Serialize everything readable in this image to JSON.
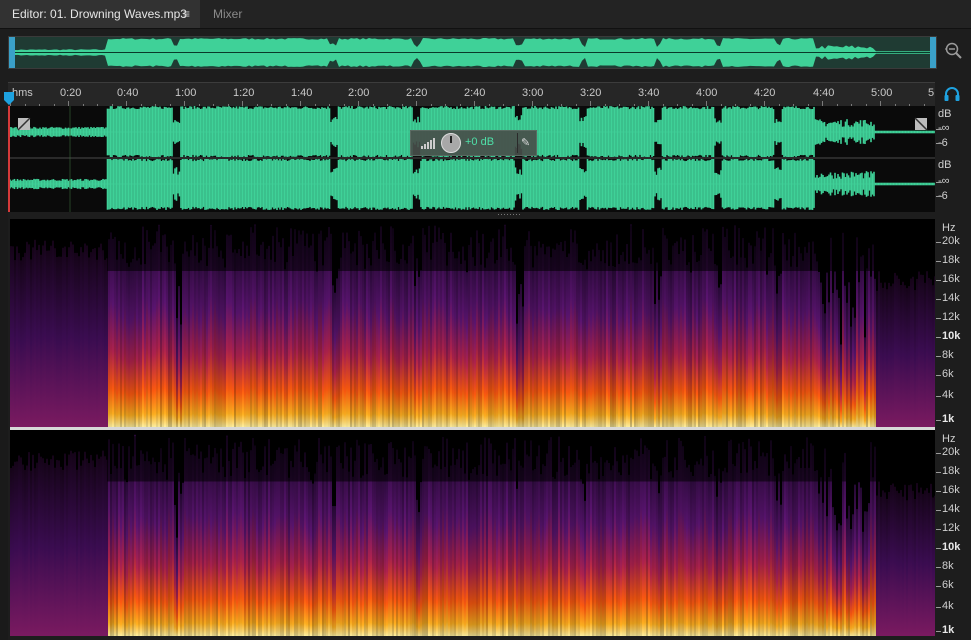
{
  "tabs": {
    "editor": "Editor: 01. Drowning Waves.mp3",
    "menu_glyph": "≡",
    "mixer": "Mixer"
  },
  "ruler": {
    "unit": "hms",
    "labels": [
      "0:20",
      "0:40",
      "1:00",
      "1:20",
      "1:40",
      "2:00",
      "2:20",
      "2:40",
      "3:00",
      "3:20",
      "3:40",
      "4:00",
      "4:20",
      "4:40",
      "5:00",
      "5"
    ]
  },
  "channels": [
    {
      "db_unit": "dB",
      "inf": "-∞",
      "minus6": "-6"
    },
    {
      "db_unit": "dB",
      "inf": "-∞",
      "minus6": "-6"
    }
  ],
  "hud": {
    "gain": "+0 dB"
  },
  "spectral": {
    "unit": "Hz",
    "labels": [
      "20k",
      "18k",
      "16k",
      "14k",
      "12k",
      "10k",
      "8k",
      "6k",
      "4k",
      "1k"
    ]
  },
  "colors": {
    "wave": "#3fd198",
    "accent": "#1ea2e0",
    "playhead": "#d63a3a"
  }
}
